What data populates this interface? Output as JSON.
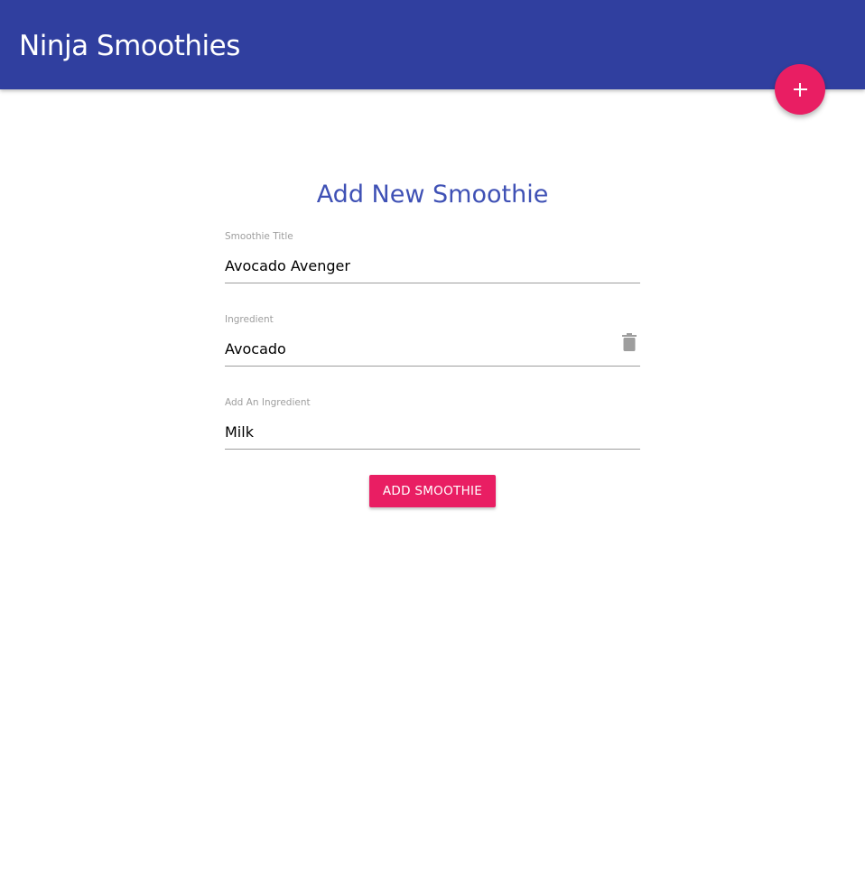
{
  "navbar": {
    "brand": "Ninja Smoothies",
    "color": "#303f9f"
  },
  "fab": {
    "icon": "add-icon",
    "color": "#e91e63"
  },
  "form": {
    "title": "Add New Smoothie",
    "fields": [
      {
        "label": "Smoothie Title",
        "value": "Avocado Avenger"
      },
      {
        "label": "Ingredient",
        "value": "Avocado",
        "action_icon": "delete-icon"
      },
      {
        "label": "Add An Ingredient",
        "value": "Milk"
      }
    ],
    "submit_label": "ADD SMOOTHIE",
    "accent": "#e91e63",
    "title_color": "#3f51b5"
  }
}
